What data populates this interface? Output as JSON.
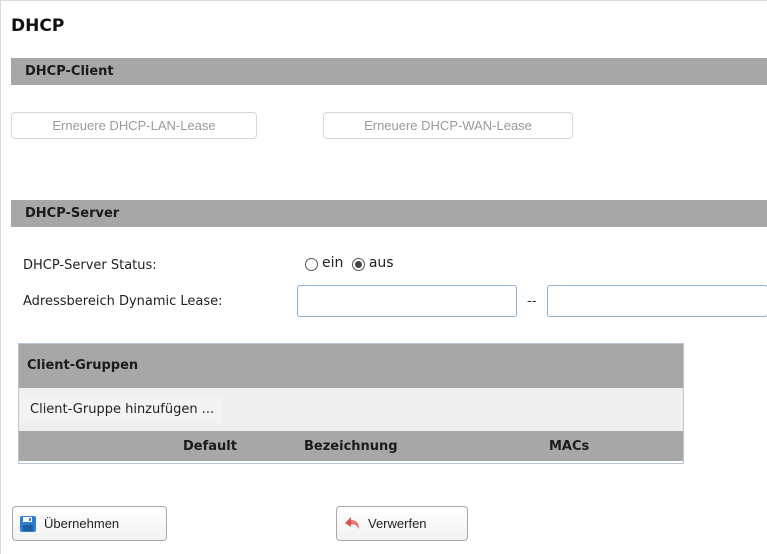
{
  "page": {
    "title": "DHCP"
  },
  "dhcp_client": {
    "header": "DHCP-Client",
    "renew_lan_label": "Erneuere DHCP-LAN-Lease",
    "renew_wan_label": "Erneuere DHCP-WAN-Lease"
  },
  "dhcp_server": {
    "header": "DHCP-Server",
    "status_label": "DHCP-Server Status:",
    "status_options": [
      {
        "label": "ein",
        "selected": false
      },
      {
        "label": "aus",
        "selected": true
      }
    ],
    "range_label": "Adressbereich Dynamic Lease:",
    "range_separator": "--",
    "range_start_value": "",
    "range_end_value": ""
  },
  "client_groups": {
    "header": "Client-Gruppen",
    "add_label": "Client-Gruppe hinzufügen ...",
    "columns": [
      "Default",
      "Bezeichnung",
      "MACs"
    ],
    "rows": []
  },
  "actions": {
    "apply_label": "Übernehmen",
    "discard_label": "Verwerfen",
    "apply_icon": "save-icon",
    "discard_icon": "undo-icon"
  },
  "colors": {
    "section_header": "#a7a7a7",
    "input_border": "#8fb0cf",
    "save_icon": "#2f7fd0",
    "discard_icon": "#d9534f"
  }
}
